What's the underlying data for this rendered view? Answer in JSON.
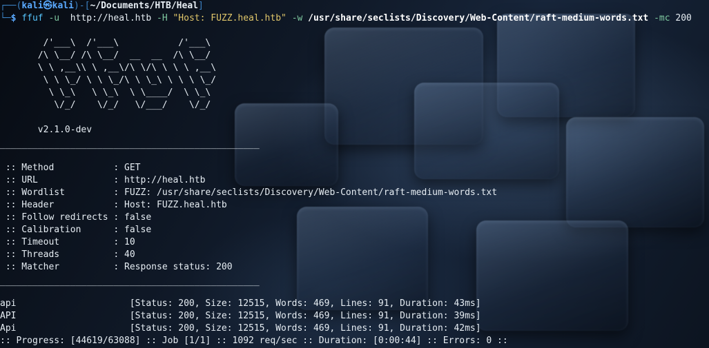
{
  "prompt": {
    "user": "kali",
    "host": "kali",
    "at_symbol": "㉿",
    "cwd": "~/Documents/HTB/Heal",
    "symbol": "$"
  },
  "command": {
    "program": "ffuf",
    "flag_u": "-u",
    "url": "http://heal.htb",
    "flag_H": "-H",
    "header": "\"Host: FUZZ.heal.htb\"",
    "flag_w": "-w",
    "wordlist": "/usr/share/seclists/Discovery/Web-Content/raft-medium-words.txt",
    "flag_mc": "-mc",
    "mc_value": "200"
  },
  "banner": {
    "art": [
      "        /'___\\  /'___\\           /'___\\",
      "       /\\ \\__/ /\\ \\__/  __  __  /\\ \\__/",
      "       \\ \\ ,__\\\\ \\ ,__\\/\\ \\/\\ \\ \\ \\ ,__\\",
      "        \\ \\ \\_/ \\ \\ \\_/\\ \\ \\_\\ \\ \\ \\ \\_/",
      "         \\ \\_\\   \\ \\_\\  \\ \\____/  \\ \\_\\",
      "          \\/_/    \\/_/   \\/___/    \\/_/"
    ],
    "version": "       v2.1.0-dev"
  },
  "separator": "________________________________________________",
  "config": [
    {
      "key": " :: Method           ",
      "value": ": GET"
    },
    {
      "key": " :: URL              ",
      "value": ": http://heal.htb"
    },
    {
      "key": " :: Wordlist         ",
      "value": ": FUZZ: /usr/share/seclists/Discovery/Web-Content/raft-medium-words.txt"
    },
    {
      "key": " :: Header           ",
      "value": ": Host: FUZZ.heal.htb"
    },
    {
      "key": " :: Follow redirects ",
      "value": ": false"
    },
    {
      "key": " :: Calibration      ",
      "value": ": false"
    },
    {
      "key": " :: Timeout          ",
      "value": ": 10"
    },
    {
      "key": " :: Threads          ",
      "value": ": 40"
    },
    {
      "key": " :: Matcher          ",
      "value": ": Response status: 200"
    }
  ],
  "results": [
    {
      "word": "api                     ",
      "status": "[Status: 200, Size: 12515, Words: 469, Lines: 91, Duration: 43ms]"
    },
    {
      "word": "API                     ",
      "status": "[Status: 200, Size: 12515, Words: 469, Lines: 91, Duration: 39ms]"
    },
    {
      "word": "Api                     ",
      "status": "[Status: 200, Size: 12515, Words: 469, Lines: 91, Duration: 42ms]"
    }
  ],
  "progress": ":: Progress: [44619/63088] :: Job [1/1] :: 1092 req/sec :: Duration: [0:00:44] :: Errors: 0 ::",
  "colors": {
    "prompt_blue": "#5aa9ff",
    "bracket_blue": "#3b82c4",
    "command_cyan": "#57c7ff",
    "flag_green": "#7ec8a0",
    "string_yellow": "#e0c66a",
    "text": "#e6edf3"
  }
}
